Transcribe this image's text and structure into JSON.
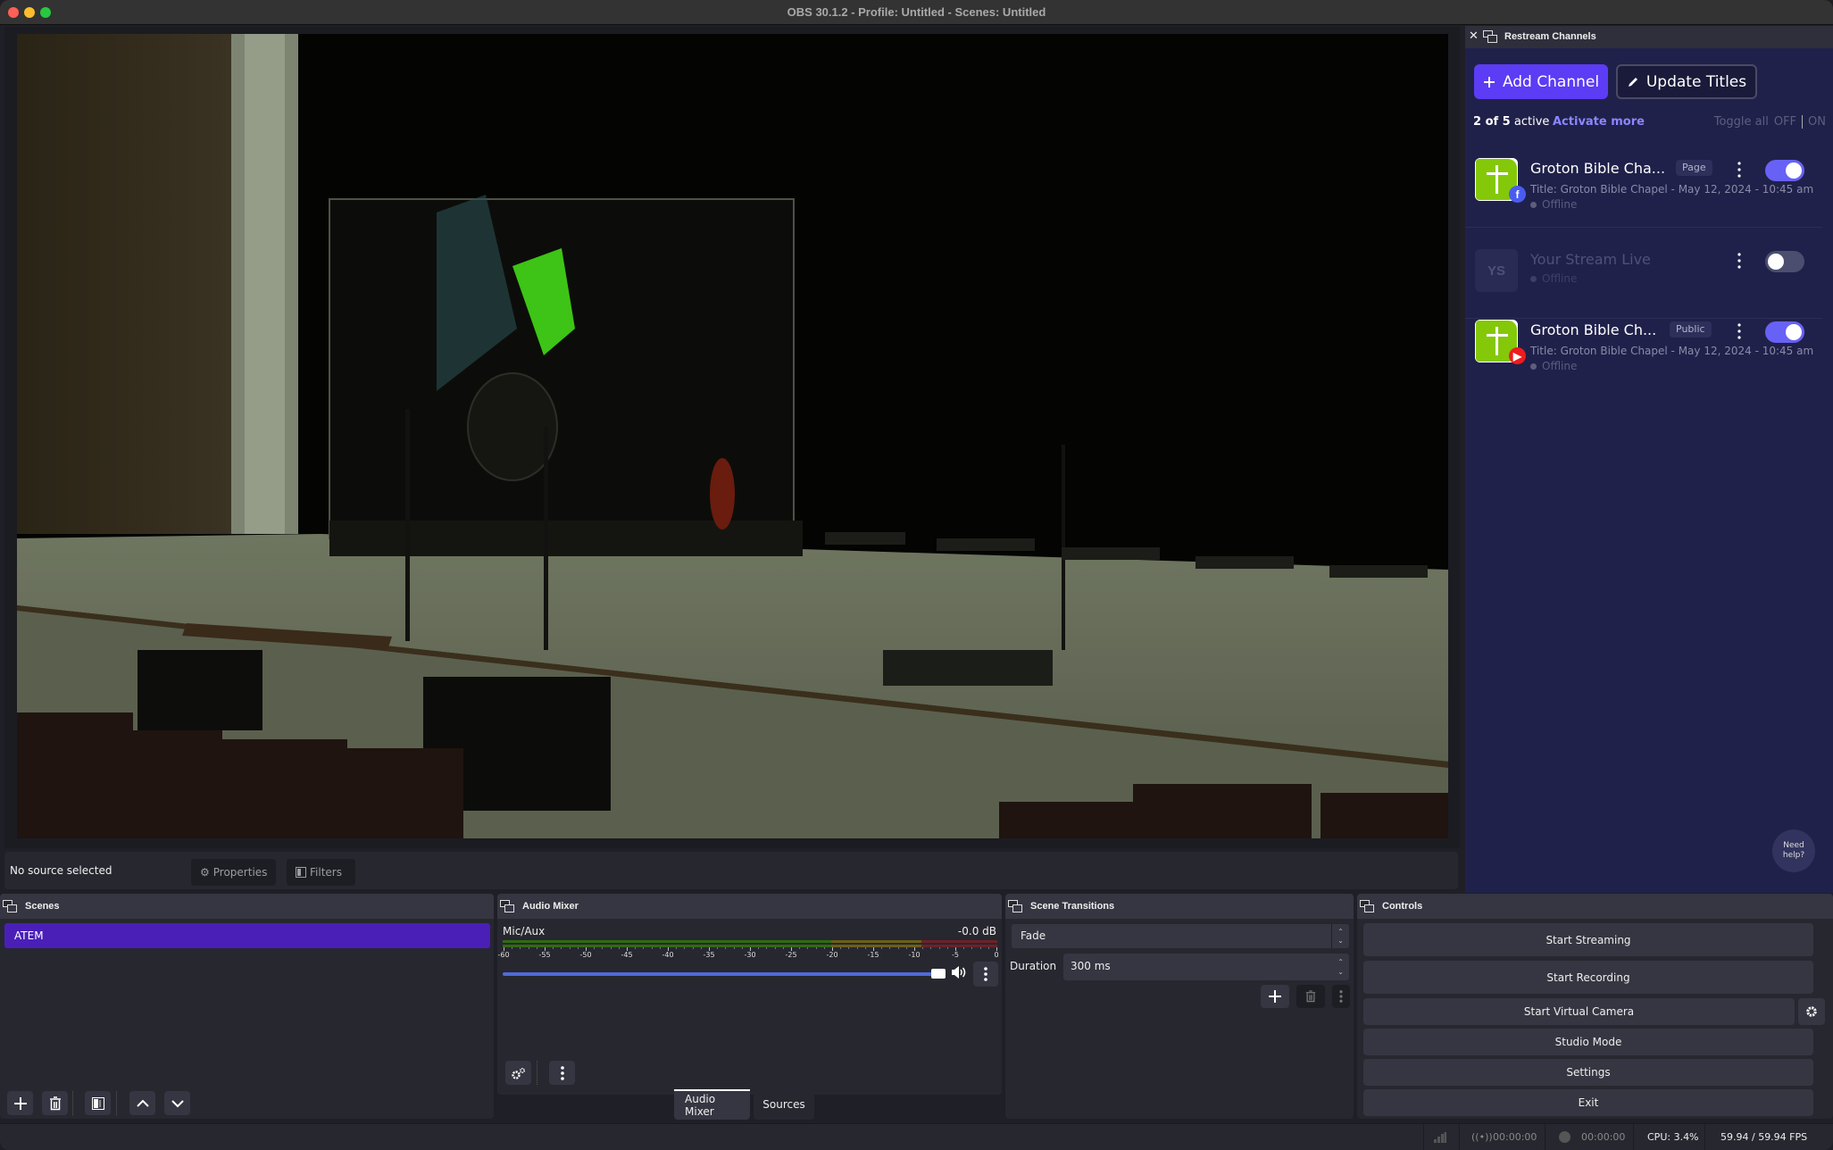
{
  "window": {
    "title": "OBS 30.1.2 - Profile: Untitled - Scenes: Untitled"
  },
  "source_toolbar": {
    "no_source_label": "No source selected",
    "properties_label": "Properties",
    "filters_label": "Filters"
  },
  "scenes": {
    "title": "Scenes",
    "items": [
      {
        "name": "ATEM",
        "selected": true
      }
    ]
  },
  "audio_mixer": {
    "title": "Audio Mixer",
    "channels": [
      {
        "name": "Mic/Aux",
        "level": "-0.0 dB",
        "volume_fraction": 0.97
      }
    ],
    "scale_ticks": [
      "-60",
      "-55",
      "-50",
      "-45",
      "-40",
      "-35",
      "-30",
      "-25",
      "-20",
      "-15",
      "-10",
      "-5",
      "0"
    ]
  },
  "dock_tabs": [
    {
      "label": "Audio Mixer",
      "active": true
    },
    {
      "label": "Sources",
      "active": false
    }
  ],
  "scene_transitions": {
    "title": "Scene Transitions",
    "transition": "Fade",
    "duration_label": "Duration",
    "duration_value": "300 ms"
  },
  "controls": {
    "title": "Controls",
    "buttons": {
      "start_streaming": "Start Streaming",
      "start_recording": "Start Recording",
      "start_virtual_camera": "Start Virtual Camera",
      "studio_mode": "Studio Mode",
      "settings": "Settings",
      "exit": "Exit"
    }
  },
  "status_bar": {
    "stream_time": "00:00:00",
    "record_time": "00:00:00",
    "cpu": "CPU: 3.4%",
    "fps": "59.94 / 59.94 FPS"
  },
  "restream": {
    "title": "Restream Channels",
    "add_channel": "Add Channel",
    "update_titles": "Update Titles",
    "active_count_num": "2 of 5",
    "active_count_suffix": " active",
    "activate_more": "Activate more",
    "toggle_all": "Toggle all",
    "off_label": "OFF",
    "on_label": "ON",
    "need_help_line1": "Need",
    "need_help_line2": "help?",
    "channels": [
      {
        "name": "Groton Bible Cha...",
        "tag": "Page",
        "platform": "facebook",
        "title": "Title: Groton Bible Chapel - May 12, 2024 - 10:45 am",
        "status": "Offline",
        "enabled": true
      },
      {
        "name": "Your Stream Live",
        "initials": "YS",
        "platform": "rtmp",
        "status": "Offline",
        "enabled": false
      },
      {
        "name": "Groton Bible Ch...",
        "tag": "Public",
        "platform": "youtube",
        "title": "Title: Groton Bible Chapel - May 12, 2024 - 10:45 am",
        "status": "Offline",
        "enabled": true
      }
    ]
  },
  "colors": {
    "accent_purple": "#5d3cf5",
    "toggle_on": "#6861f5",
    "scene_selected": "#4a1fb8",
    "volume_slider": "#4f6ad8"
  }
}
